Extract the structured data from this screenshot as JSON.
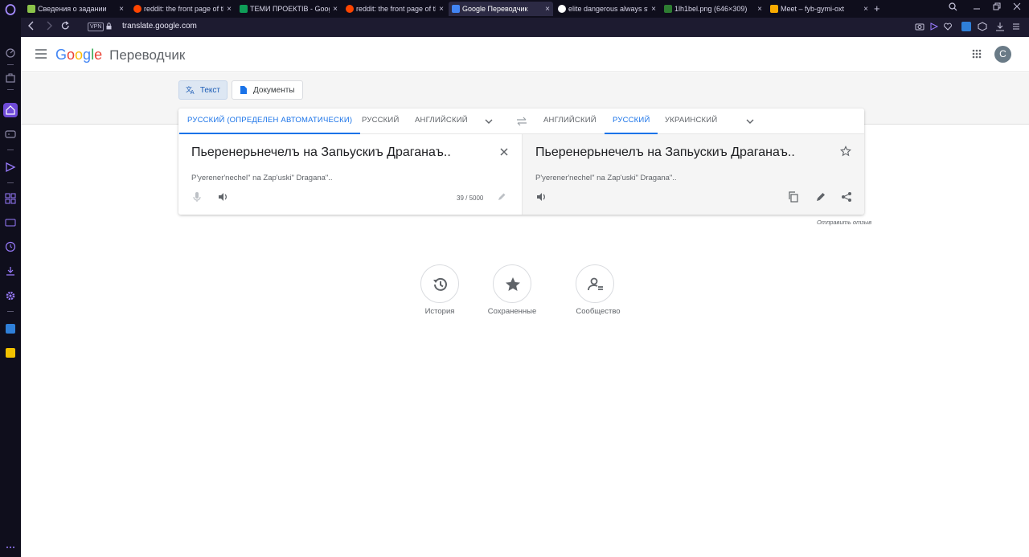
{
  "browser": {
    "tabs": [
      {
        "title": "Сведения о задании",
        "favicon_color": "#8bc34a"
      },
      {
        "title": "reddit: the front page of the",
        "favicon_color": "#ff4500"
      },
      {
        "title": "ТЕМИ ПРОЕКТІВ - Google",
        "favicon_color": "#0f9d58"
      },
      {
        "title": "reddit: the front page of the",
        "favicon_color": "#ff4500"
      },
      {
        "title": "Google Переводчик",
        "favicon_color": "#4285f4"
      },
      {
        "title": "elite dangerous always sta",
        "favicon_color": "#ffffff"
      },
      {
        "title": "1lh1bel.png (646×309)",
        "favicon_color": "#2e7d32"
      },
      {
        "title": "Meet – fyb-gymi-oxt",
        "favicon_color": "#f9ab00"
      }
    ],
    "close_glyph": "×",
    "new_tab_glyph": "+",
    "vpn_label": "VPN",
    "url": "translate.google.com",
    "accent": "#7c5cff"
  },
  "header": {
    "logo_letters": [
      "G",
      "o",
      "o",
      "g",
      "l",
      "e"
    ],
    "product": "Переводчик",
    "avatar_letter": "С"
  },
  "modes": {
    "text": "Текст",
    "documents": "Документы"
  },
  "source_langs": [
    "РУССКИЙ (ОПРЕДЕЛЕН АВТОМАТИЧЕСКИ)",
    "РУССКИЙ",
    "АНГЛИЙСКИЙ"
  ],
  "target_langs": [
    "АНГЛИЙСКИЙ",
    "РУССКИЙ",
    "УКРАИНСКИЙ"
  ],
  "source": {
    "text": "Пьеренерьнечелъ на Запьускиъ Драганаъ..",
    "transliteration": "P'yerener'nechel\" na Zap'uski\" Dragana\"..",
    "count": "39 / 5000"
  },
  "target": {
    "text": "Пьеренерьнечелъ на Запьускиъ Драганаъ..",
    "transliteration": "P'yerener'nechel\" na Zap'uski\" Dragana\".."
  },
  "feedback": "Отправить отзыв",
  "shortcuts": [
    {
      "label": "История",
      "icon": "history-icon"
    },
    {
      "label": "Сохраненные",
      "icon": "star-icon"
    },
    {
      "label": "Сообщество",
      "icon": "community-icon"
    }
  ]
}
